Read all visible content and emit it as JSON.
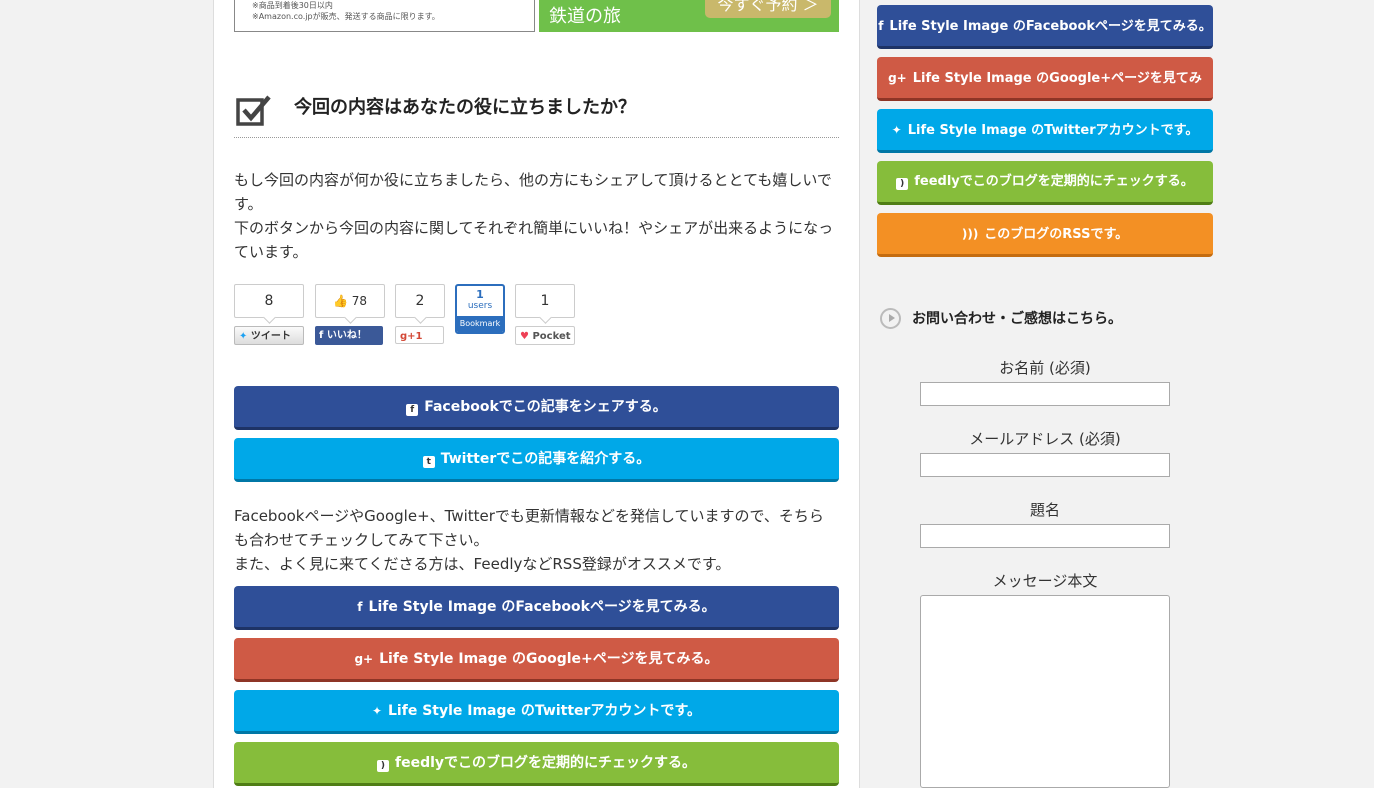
{
  "ad": {
    "line1": "※商品到着後30日以内",
    "line2": "※Amazon.co.jpが販売、発送する商品に限ります。",
    "banner_text": "鉄道の旅",
    "banner_button": "今すぐ予約 ＞"
  },
  "section": {
    "title": "今回の内容はあなたの役に立ちましたか？",
    "intro_line1": "もし今回の内容が何か役に立ちましたら、他の方にもシェアして頂けるととても嬉しいです。",
    "intro_line2": "下のボタンから今回の内容に関してそれぞれ簡単にいいね！やシェアが出来るようになっています。"
  },
  "share_counts": {
    "twitter": {
      "count": "8",
      "label": "ツイート"
    },
    "facebook": {
      "count": "78",
      "label": "いいね！"
    },
    "googleplus": {
      "count": "2",
      "label": "+1"
    },
    "hatena": {
      "count": "1",
      "unit": "users",
      "label": "Bookmark"
    },
    "pocket": {
      "count": "1",
      "label": "Pocket"
    }
  },
  "share_buttons": {
    "facebook": "Facebookでこの記事をシェアする。",
    "twitter": "Twitterでこの記事を紹介する。"
  },
  "follow_text": {
    "line1": "FacebookページやGoogle+、Twitterでも更新情報などを発信していますので、そちらも合わせてチェックしてみて下さい。",
    "line2": "また、よく見に来てくださる方は、FeedlyなどRSS登録がオススメです。"
  },
  "follow_buttons": {
    "facebook": "Life Style Image のFacebookページを見てみる。",
    "googleplus": "Life Style Image のGoogle+ページを見てみる。",
    "twitter": "Life Style Image のTwitterアカウントです。",
    "feedly": "feedlyでこのブログを定期的にチェックする。",
    "rss": "このブログのRSSです。"
  },
  "contact": {
    "heading": "お問い合わせ・ご感想はこちら。",
    "name_label": "お名前 (必須)",
    "email_label": "メールアドレス (必須)",
    "subject_label": "題名",
    "message_label": "メッセージ本文"
  },
  "colors": {
    "facebook": "#2f4f98",
    "googleplus": "#cf5a45",
    "twitter": "#00a8e8",
    "feedly": "#86bd3b",
    "rss": "#f39024"
  }
}
